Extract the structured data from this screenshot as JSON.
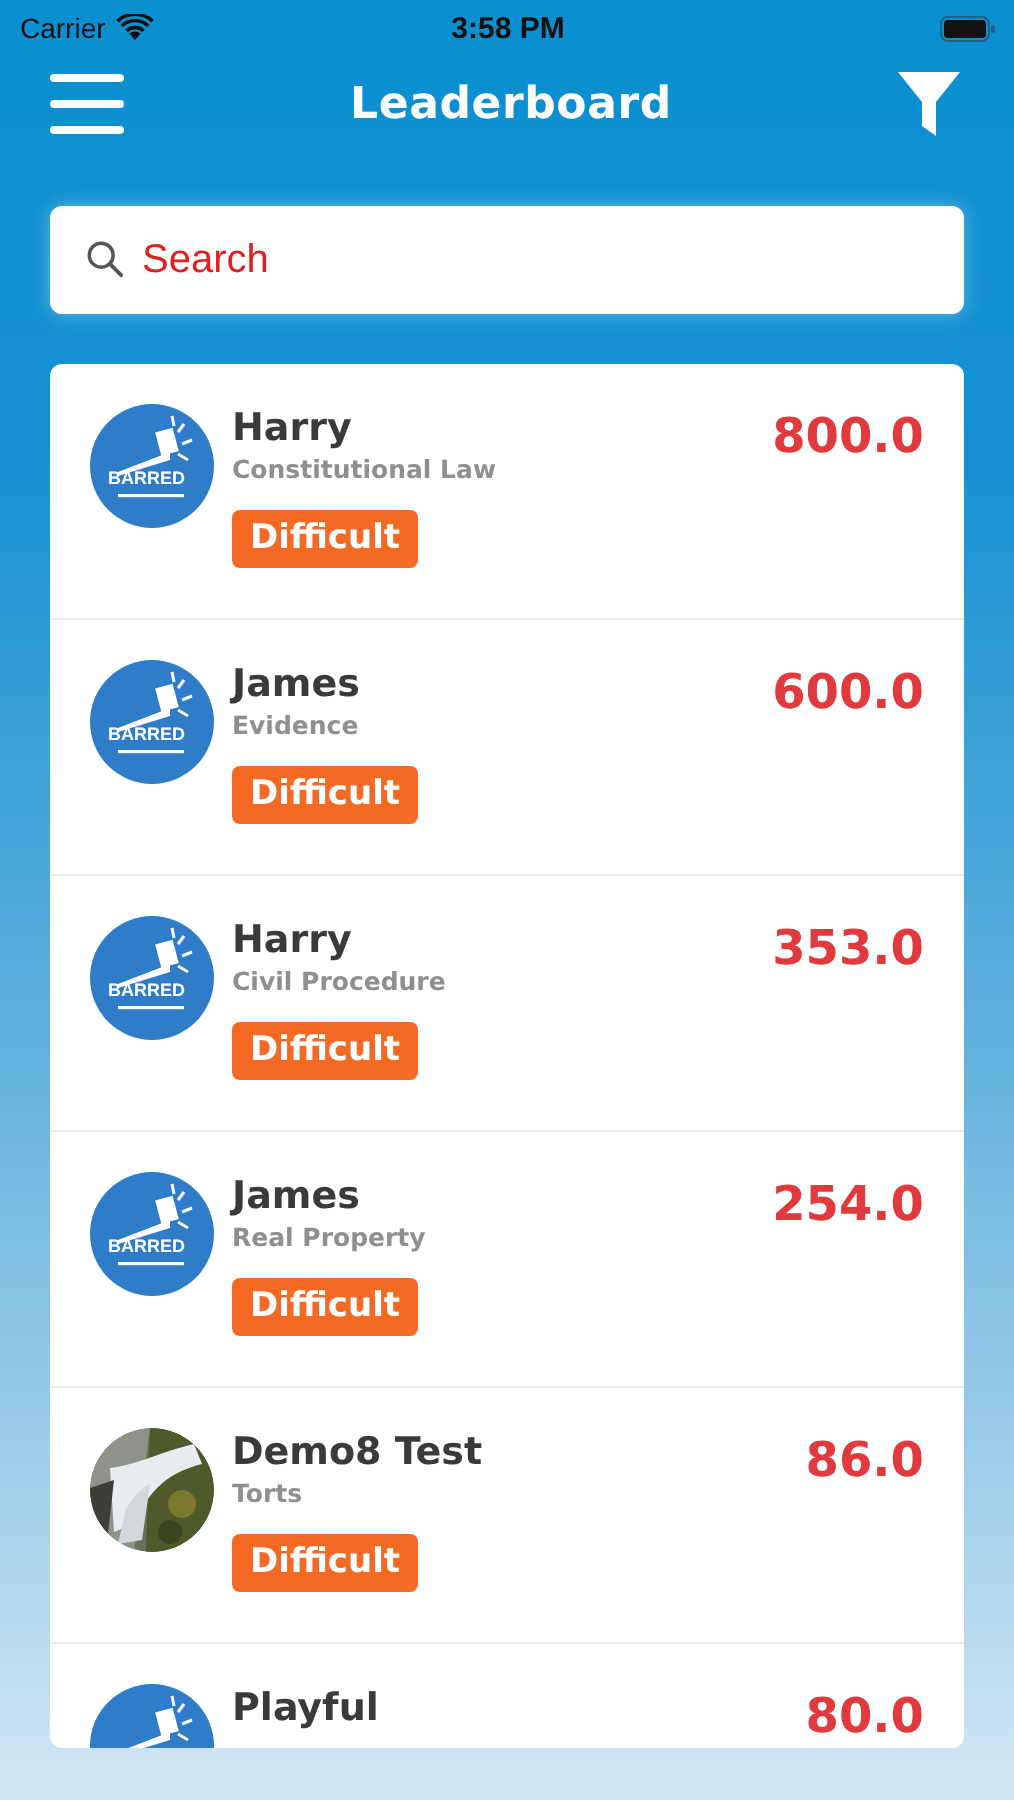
{
  "status_bar": {
    "carrier": "Carrier",
    "time": "3:58 PM"
  },
  "header": {
    "title": "Leaderboard"
  },
  "search": {
    "placeholder": "Search"
  },
  "entries": [
    {
      "name": "Harry",
      "subject": "Constitutional Law",
      "tag": "Difficult",
      "score": "800.0",
      "avatar": {
        "kind": "logo",
        "text": "BARRED"
      }
    },
    {
      "name": "James",
      "subject": "Evidence",
      "tag": "Difficult",
      "score": "600.0",
      "avatar": {
        "kind": "logo",
        "text": "BARRED"
      }
    },
    {
      "name": "Harry",
      "subject": "Civil Procedure",
      "tag": "Difficult",
      "score": "353.0",
      "avatar": {
        "kind": "logo",
        "text": "BARRED"
      }
    },
    {
      "name": "James",
      "subject": "Real Property",
      "tag": "Difficult",
      "score": "254.0",
      "avatar": {
        "kind": "logo",
        "text": "BARRED"
      }
    },
    {
      "name": "Demo8 Test",
      "subject": "Torts",
      "tag": "Difficult",
      "score": "86.0"
    },
    {
      "name": "Playful",
      "score": "80.0",
      "avatar": {
        "kind": "logo"
      }
    }
  ]
}
